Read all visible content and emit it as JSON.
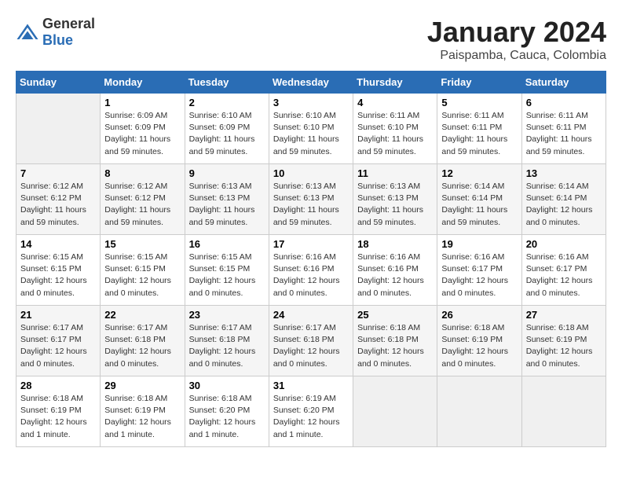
{
  "header": {
    "logo_general": "General",
    "logo_blue": "Blue",
    "title": "January 2024",
    "subtitle": "Paispamba, Cauca, Colombia"
  },
  "days_of_week": [
    "Sunday",
    "Monday",
    "Tuesday",
    "Wednesday",
    "Thursday",
    "Friday",
    "Saturday"
  ],
  "weeks": [
    [
      {
        "num": "",
        "info": ""
      },
      {
        "num": "1",
        "info": "Sunrise: 6:09 AM\nSunset: 6:09 PM\nDaylight: 11 hours\nand 59 minutes."
      },
      {
        "num": "2",
        "info": "Sunrise: 6:10 AM\nSunset: 6:09 PM\nDaylight: 11 hours\nand 59 minutes."
      },
      {
        "num": "3",
        "info": "Sunrise: 6:10 AM\nSunset: 6:10 PM\nDaylight: 11 hours\nand 59 minutes."
      },
      {
        "num": "4",
        "info": "Sunrise: 6:11 AM\nSunset: 6:10 PM\nDaylight: 11 hours\nand 59 minutes."
      },
      {
        "num": "5",
        "info": "Sunrise: 6:11 AM\nSunset: 6:11 PM\nDaylight: 11 hours\nand 59 minutes."
      },
      {
        "num": "6",
        "info": "Sunrise: 6:11 AM\nSunset: 6:11 PM\nDaylight: 11 hours\nand 59 minutes."
      }
    ],
    [
      {
        "num": "7",
        "info": "Sunrise: 6:12 AM\nSunset: 6:12 PM\nDaylight: 11 hours\nand 59 minutes."
      },
      {
        "num": "8",
        "info": "Sunrise: 6:12 AM\nSunset: 6:12 PM\nDaylight: 11 hours\nand 59 minutes."
      },
      {
        "num": "9",
        "info": "Sunrise: 6:13 AM\nSunset: 6:13 PM\nDaylight: 11 hours\nand 59 minutes."
      },
      {
        "num": "10",
        "info": "Sunrise: 6:13 AM\nSunset: 6:13 PM\nDaylight: 11 hours\nand 59 minutes."
      },
      {
        "num": "11",
        "info": "Sunrise: 6:13 AM\nSunset: 6:13 PM\nDaylight: 11 hours\nand 59 minutes."
      },
      {
        "num": "12",
        "info": "Sunrise: 6:14 AM\nSunset: 6:14 PM\nDaylight: 11 hours\nand 59 minutes."
      },
      {
        "num": "13",
        "info": "Sunrise: 6:14 AM\nSunset: 6:14 PM\nDaylight: 12 hours\nand 0 minutes."
      }
    ],
    [
      {
        "num": "14",
        "info": "Sunrise: 6:15 AM\nSunset: 6:15 PM\nDaylight: 12 hours\nand 0 minutes."
      },
      {
        "num": "15",
        "info": "Sunrise: 6:15 AM\nSunset: 6:15 PM\nDaylight: 12 hours\nand 0 minutes."
      },
      {
        "num": "16",
        "info": "Sunrise: 6:15 AM\nSunset: 6:15 PM\nDaylight: 12 hours\nand 0 minutes."
      },
      {
        "num": "17",
        "info": "Sunrise: 6:16 AM\nSunset: 6:16 PM\nDaylight: 12 hours\nand 0 minutes."
      },
      {
        "num": "18",
        "info": "Sunrise: 6:16 AM\nSunset: 6:16 PM\nDaylight: 12 hours\nand 0 minutes."
      },
      {
        "num": "19",
        "info": "Sunrise: 6:16 AM\nSunset: 6:17 PM\nDaylight: 12 hours\nand 0 minutes."
      },
      {
        "num": "20",
        "info": "Sunrise: 6:16 AM\nSunset: 6:17 PM\nDaylight: 12 hours\nand 0 minutes."
      }
    ],
    [
      {
        "num": "21",
        "info": "Sunrise: 6:17 AM\nSunset: 6:17 PM\nDaylight: 12 hours\nand 0 minutes."
      },
      {
        "num": "22",
        "info": "Sunrise: 6:17 AM\nSunset: 6:18 PM\nDaylight: 12 hours\nand 0 minutes."
      },
      {
        "num": "23",
        "info": "Sunrise: 6:17 AM\nSunset: 6:18 PM\nDaylight: 12 hours\nand 0 minutes."
      },
      {
        "num": "24",
        "info": "Sunrise: 6:17 AM\nSunset: 6:18 PM\nDaylight: 12 hours\nand 0 minutes."
      },
      {
        "num": "25",
        "info": "Sunrise: 6:18 AM\nSunset: 6:18 PM\nDaylight: 12 hours\nand 0 minutes."
      },
      {
        "num": "26",
        "info": "Sunrise: 6:18 AM\nSunset: 6:19 PM\nDaylight: 12 hours\nand 0 minutes."
      },
      {
        "num": "27",
        "info": "Sunrise: 6:18 AM\nSunset: 6:19 PM\nDaylight: 12 hours\nand 0 minutes."
      }
    ],
    [
      {
        "num": "28",
        "info": "Sunrise: 6:18 AM\nSunset: 6:19 PM\nDaylight: 12 hours\nand 1 minute."
      },
      {
        "num": "29",
        "info": "Sunrise: 6:18 AM\nSunset: 6:19 PM\nDaylight: 12 hours\nand 1 minute."
      },
      {
        "num": "30",
        "info": "Sunrise: 6:18 AM\nSunset: 6:20 PM\nDaylight: 12 hours\nand 1 minute."
      },
      {
        "num": "31",
        "info": "Sunrise: 6:19 AM\nSunset: 6:20 PM\nDaylight: 12 hours\nand 1 minute."
      },
      {
        "num": "",
        "info": ""
      },
      {
        "num": "",
        "info": ""
      },
      {
        "num": "",
        "info": ""
      }
    ]
  ]
}
